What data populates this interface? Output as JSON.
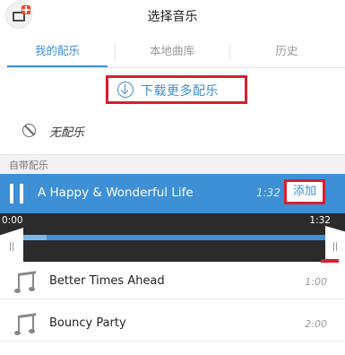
{
  "header": {
    "title": "选择音乐",
    "app_icon": "add-video-icon"
  },
  "tabs": [
    {
      "label": "我的配乐",
      "active": true
    },
    {
      "label": "本地曲库",
      "active": false
    },
    {
      "label": "历史",
      "active": false
    }
  ],
  "download": {
    "label": "下载更多配乐",
    "icon": "download-circle-icon"
  },
  "no_music": {
    "label": "无配乐",
    "icon": "ban-icon"
  },
  "section": {
    "label": "自带配乐"
  },
  "playing": {
    "title": "A Happy & Wonderful Life",
    "duration": "1:32",
    "add_label": "添加",
    "time_start": "0:00",
    "time_end": "1:32"
  },
  "tracks": [
    {
      "title": "Better Times Ahead",
      "duration": "1:00"
    },
    {
      "title": "Bouncy Party",
      "duration": "2:00"
    }
  ],
  "colors": {
    "accent": "#3d8fd6",
    "highlight_box": "#d6202d",
    "progress_bg": "#2b2b2b"
  }
}
